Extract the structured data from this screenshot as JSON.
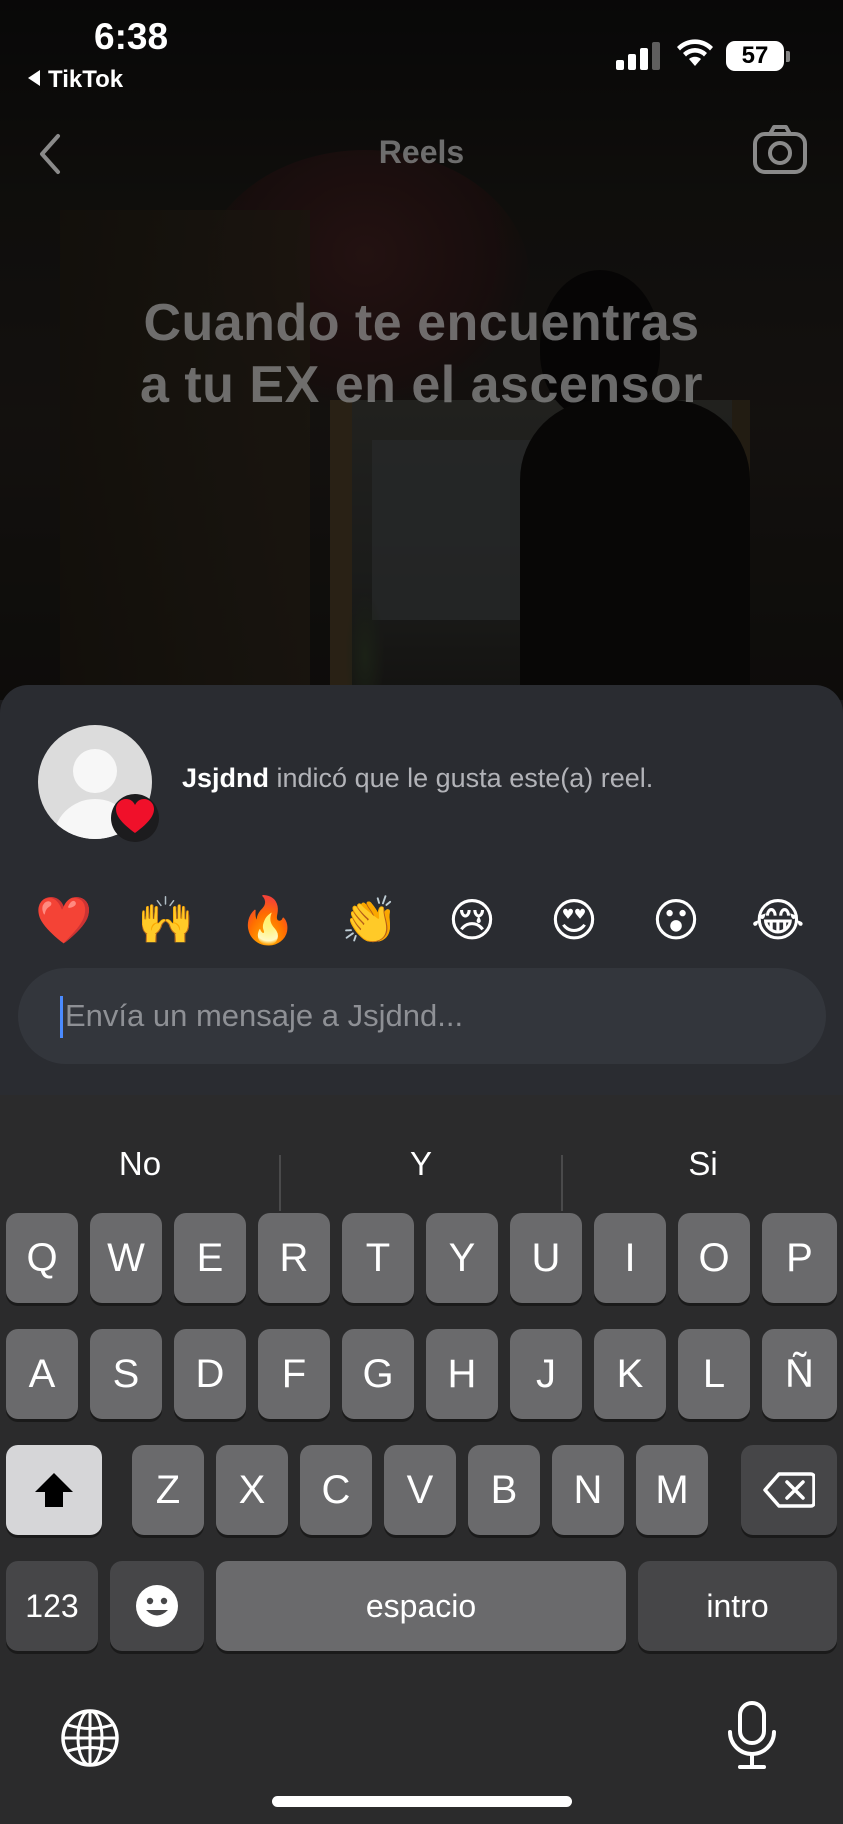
{
  "status_bar": {
    "time": "6:38",
    "back_app": "TikTok",
    "battery": "57"
  },
  "nav": {
    "title": "Reels"
  },
  "video": {
    "caption_line1": "Cuando te encuentras",
    "caption_line2": "a tu EX en el ascensor"
  },
  "notification": {
    "username": "Jsjdnd",
    "text": "indicó que le gusta este(a) reel."
  },
  "reactions": [
    "❤️",
    "🙌",
    "🔥",
    "👏",
    "😢",
    "😍",
    "😮",
    "😂"
  ],
  "message": {
    "placeholder": "Envía un mensaje a Jsjdnd..."
  },
  "keyboard": {
    "suggestions": [
      "No",
      "Y",
      "Si"
    ],
    "row1": [
      "Q",
      "W",
      "E",
      "R",
      "T",
      "Y",
      "U",
      "I",
      "O",
      "P"
    ],
    "row2": [
      "A",
      "S",
      "D",
      "F",
      "G",
      "H",
      "J",
      "K",
      "L",
      "Ñ"
    ],
    "row3": [
      "Z",
      "X",
      "C",
      "V",
      "B",
      "N",
      "M"
    ],
    "numbers_key": "123",
    "space_key": "espacio",
    "return_key": "intro"
  },
  "colors": {
    "sheet_bg": "#2a2c31",
    "input_bg": "#33363c",
    "caret": "#4b8bff",
    "key": "#6a6a6c",
    "key_dark": "#464648"
  }
}
